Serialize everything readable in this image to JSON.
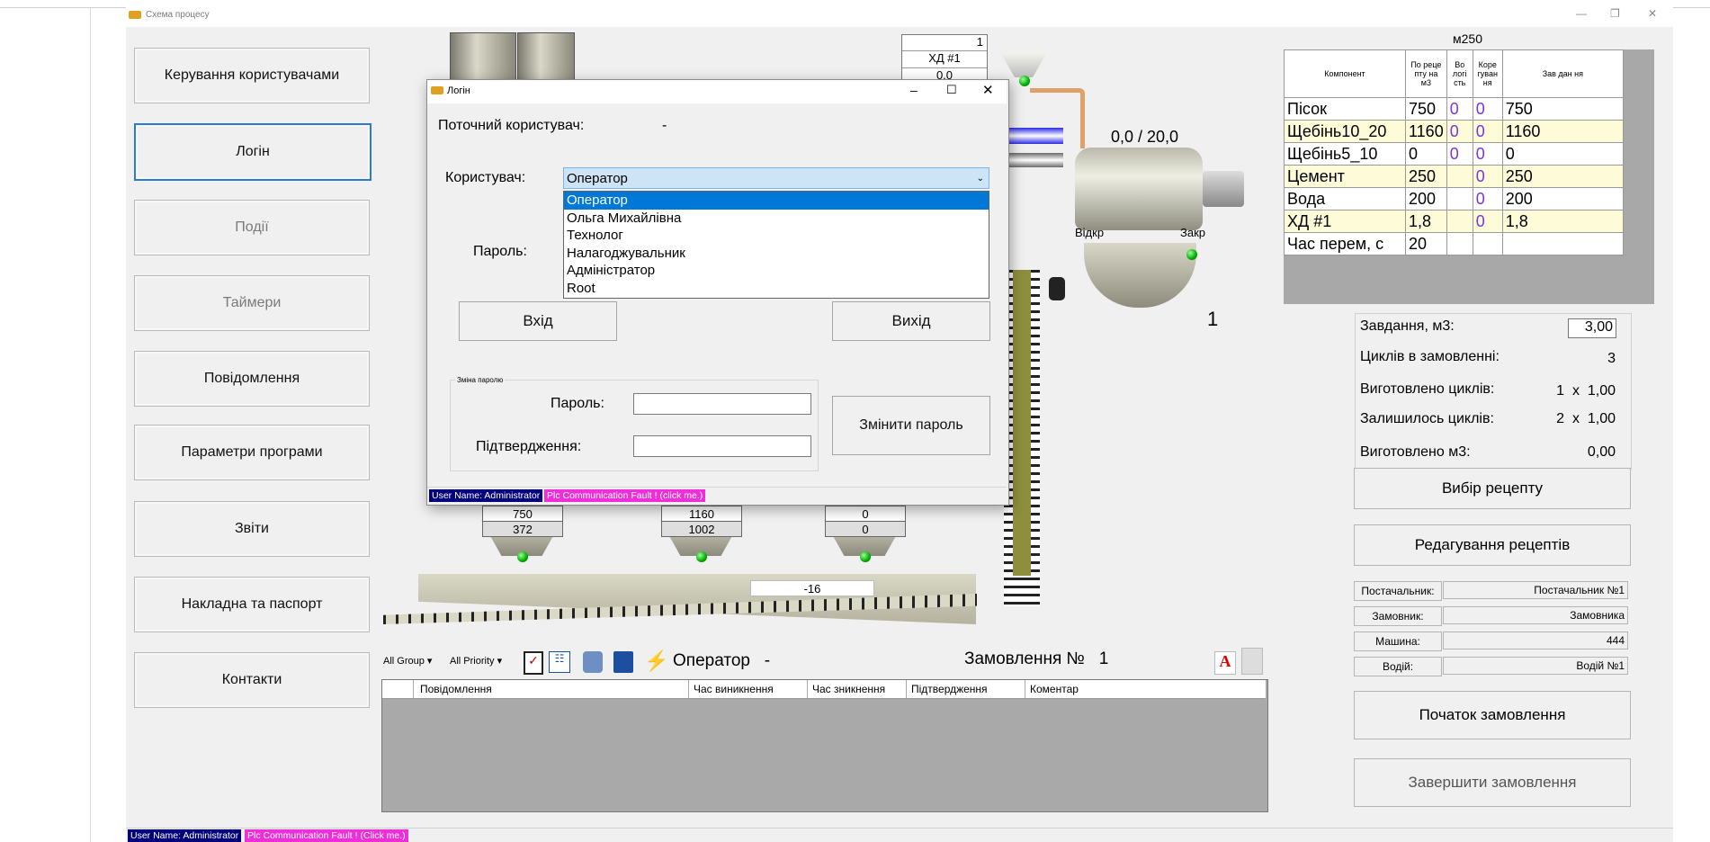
{
  "window": {
    "title": "Схема процесу",
    "min": "—",
    "max": "❐",
    "close": "✕"
  },
  "nav": [
    {
      "label": "Керування користувачами",
      "state": "normal"
    },
    {
      "label": "Логін",
      "state": "selected"
    },
    {
      "label": "Події",
      "state": "disabled"
    },
    {
      "label": "Таймери",
      "state": "disabled"
    },
    {
      "label": "Повідомлення",
      "state": "normal"
    },
    {
      "label": "Параметри програми",
      "state": "normal"
    },
    {
      "label": "Звіти",
      "state": "normal"
    },
    {
      "label": "Накладна та паспорт",
      "state": "normal"
    },
    {
      "label": "Контакти",
      "state": "normal"
    }
  ],
  "process": {
    "admix_counter": "1",
    "admix_name": "ХД #1",
    "admix_value": "0,0",
    "mixer_reading": "0,0  /  20,0",
    "open_label": "Відкр",
    "close_label": "Закр",
    "cycle_number": "1",
    "hoppers": [
      {
        "set": "750",
        "actual": "372"
      },
      {
        "set": "1160",
        "actual": "1002"
      },
      {
        "set": "0",
        "actual": "0"
      }
    ],
    "conveyor_value": "-16"
  },
  "recipe": {
    "name": "м250",
    "headers": [
      "Компонент",
      "По реце пту на м3",
      "Во логі сть",
      "Коре гуван ня",
      "Зав дан ня"
    ],
    "rows": [
      [
        "Пісок",
        "750",
        "0",
        "0",
        "750"
      ],
      [
        "Щебінь10_20",
        "1160",
        "0",
        "0",
        "1160"
      ],
      [
        "Щебінь5_10",
        "0",
        "0",
        "0",
        "0"
      ],
      [
        "Цемент",
        "250",
        "",
        "0",
        "250"
      ],
      [
        "Вода",
        "200",
        "",
        "0",
        "200"
      ],
      [
        "ХД #1",
        "1,8",
        "",
        "0",
        "1,8"
      ],
      [
        "Час перем, с",
        "20",
        "",
        "",
        ""
      ]
    ]
  },
  "order_info": {
    "task_label": "Завдання, м3:",
    "task_value": "3,00",
    "cycles_label": "Циклів в замовленні:",
    "cycles_value": "3",
    "made_label": "Виготовлено циклів:",
    "made_value": "1  x  1,00",
    "left_label": "Залишилось циклів:",
    "left_value": "2  x  1,00",
    "made_m3_label": "Виготовлено м3:",
    "made_m3_value": "0,00",
    "recipe_select": "Вибір рецепту",
    "recipe_edit": "Редагування рецептів",
    "supplier_label": "Постачальник:",
    "supplier_value": "Постачальник №1",
    "customer_label": "Замовник:",
    "customer_value": "Замовника",
    "truck_label": "Машина:",
    "truck_value": "444",
    "driver_label": "Водій:",
    "driver_value": "Водій №1",
    "start_order": "Початок замовлення",
    "finish_order": "Завершити замовлення"
  },
  "alarm": {
    "group_filter": "All Group",
    "priority_filter": "All Priority",
    "operator": "Оператор   -",
    "order_label": "Замовлення №   1",
    "columns": [
      "Повідомлення",
      "Час виникнення",
      "Час зникнення",
      "Підтвердження",
      "Коментар"
    ]
  },
  "status": {
    "user": "User Name: Administrator",
    "fault": "Plc Communication Fault ! (Click me.)"
  },
  "dialog": {
    "title": "Логін",
    "current_user_label": "Поточний користувач:",
    "current_user_value": "-",
    "user_label": "Користувач:",
    "selected_user": "Оператор",
    "options": [
      "Оператор",
      "Ольга Михайлівна",
      "Технолог",
      "Налагоджувальник",
      "Адміністратор",
      "Root"
    ],
    "password_label": "Пароль:",
    "login_button": "Вхід",
    "exit_button": "Вихід",
    "change_group": "Зміна паролю",
    "new_password_label": "Пароль:",
    "confirm_label": "Підтвердження:",
    "change_button": "Змінити пароль",
    "status_user": "User Name: Administrator",
    "status_fault": "Plc Communication Fault ! (click me.)"
  }
}
